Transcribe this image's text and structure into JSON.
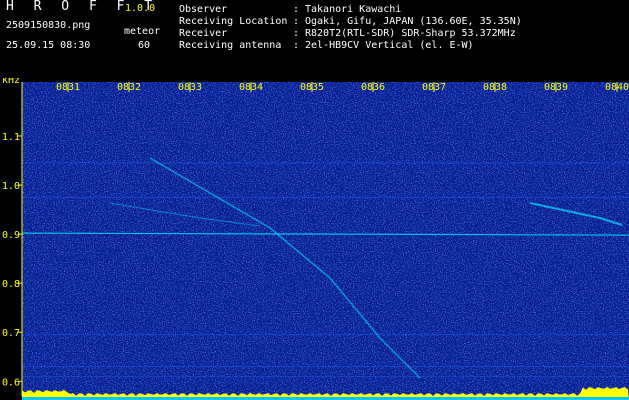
{
  "header": {
    "app_title": "H R O F F T",
    "version": "1.0.0",
    "filename": "2509150830.png",
    "meteor_label": "meteor",
    "datetime": "25.09.15 08:30",
    "meteor_count": "60"
  },
  "info": [
    {
      "label": "Observer",
      "value": "Takanori Kawachi"
    },
    {
      "label": "Receiving Location",
      "value": "Ogaki, Gifu, JAPAN (136.60E, 35.35N)"
    },
    {
      "label": "Receiver",
      "value": "R820T2(RTL-SDR) SDR-Sharp 53.372MHz"
    },
    {
      "label": "Receiving antenna",
      "value": "2el-HB9CV Vertical (el. E-W)"
    }
  ],
  "info_separator": ":",
  "axis": {
    "unit": "kHz",
    "y_ticks": [
      "1.1",
      "1.0",
      "0.9",
      "0.8",
      "0.7",
      "0.6"
    ],
    "y_values": [
      1.1,
      1.0,
      0.9,
      0.8,
      0.7,
      0.6
    ],
    "y_range": [
      0.57,
      1.21
    ],
    "time_ticks": [
      "0831",
      "0832",
      "0833",
      "0834",
      "0835",
      "0836",
      "0837",
      "0838",
      "0839",
      "0840"
    ]
  },
  "colors": {
    "background": "#000000",
    "spectrum_base": "#0a1a8c",
    "noise_hi": "#2060ff",
    "signal": "#00e0ff",
    "baseline_fill": "#ffff00",
    "text_white": "#ffffff",
    "text_yellow": "#ffff00"
  }
}
